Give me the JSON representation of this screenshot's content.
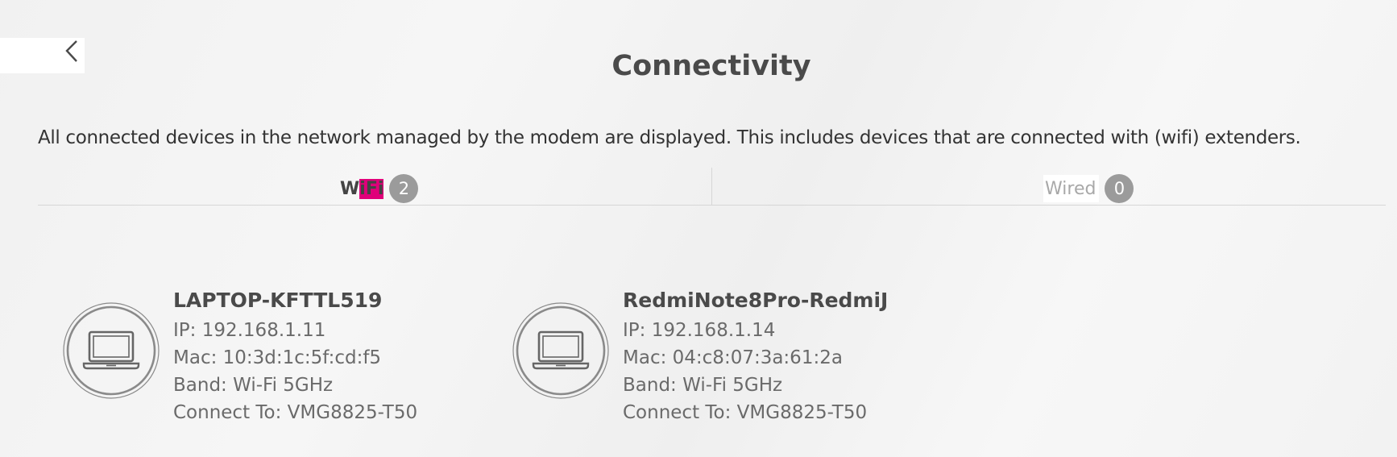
{
  "header": {
    "title": "Connectivity",
    "back_icon": "chevron-left-icon"
  },
  "description": "All connected devices in the network managed by the modem are displayed. This includes devices that are connected with (wifi) extenders.",
  "tabs": [
    {
      "label_prefix": "W",
      "label_highlight": "iFi",
      "count": "2",
      "active": true
    },
    {
      "label": "Wired",
      "count": "0",
      "active": false
    }
  ],
  "devices": [
    {
      "icon": "laptop-icon",
      "name": "LAPTOP-KFTTL519",
      "ip": "IP: 192.168.1.11",
      "mac": "Mac: 10:3d:1c:5f:cd:f5",
      "band": "Band: Wi-Fi 5GHz",
      "connect_to": "Connect To: VMG8825-T50"
    },
    {
      "icon": "laptop-icon",
      "name": "RedmiNote8Pro-RedmiJ",
      "ip": "IP: 192.168.1.14",
      "mac": "Mac: 04:c8:07:3a:61:2a",
      "band": "Band: Wi-Fi 5GHz",
      "connect_to": "Connect To: VMG8825-T50"
    }
  ],
  "colors": {
    "accent_highlight": "#e0007a",
    "badge": "#9b9b9b"
  }
}
